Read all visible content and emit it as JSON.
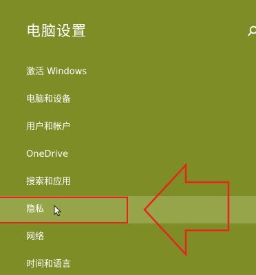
{
  "header": {
    "title": "电脑设置",
    "search_icon": "search-icon"
  },
  "nav": {
    "items": [
      {
        "label": "激活 Windows"
      },
      {
        "label": "电脑和设备"
      },
      {
        "label": "用户和帐户"
      },
      {
        "label": "OneDrive"
      },
      {
        "label": "搜索和应用"
      },
      {
        "label": "隐私",
        "selected": true
      },
      {
        "label": "网络"
      },
      {
        "label": "时间和语言"
      }
    ]
  },
  "annotation": {
    "box_color": "#e8241c",
    "arrow_color": "#e8241c"
  },
  "colors": {
    "background": "#7f8d27",
    "selected": "#96a54a"
  }
}
